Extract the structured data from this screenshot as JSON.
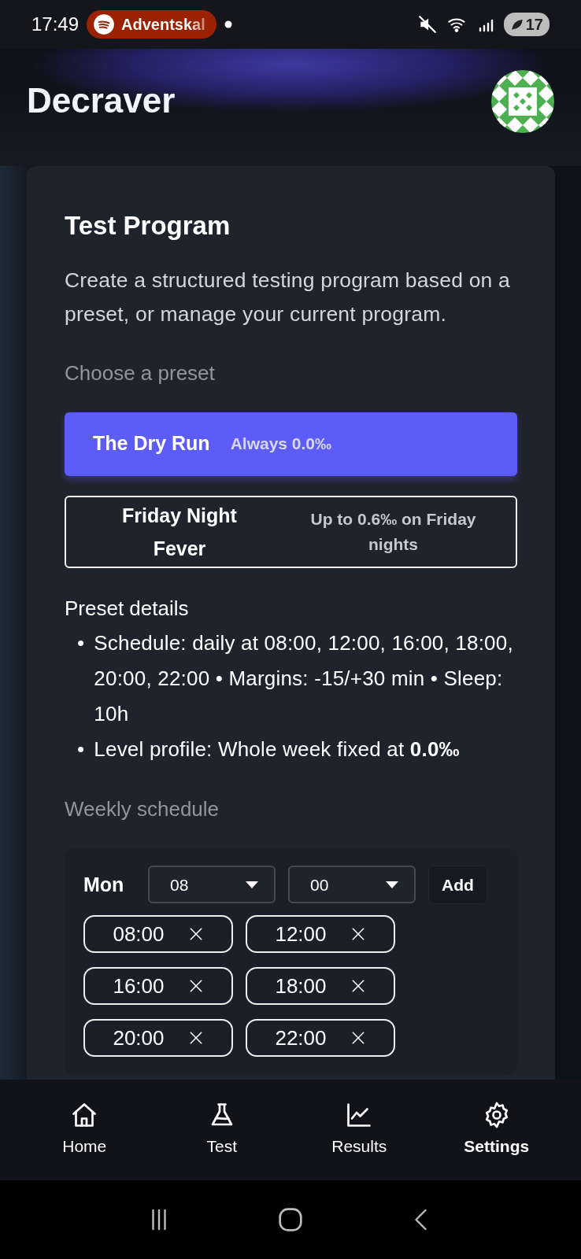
{
  "status_bar": {
    "time": "17:49",
    "media": "Adventskal",
    "battery": "17"
  },
  "app": {
    "title": "Decraver"
  },
  "card": {
    "title": "Test Program",
    "description": "Create a structured testing program based on a preset, or manage your current program.",
    "preset_label": "Choose a preset",
    "presets": [
      {
        "name": "The Dry Run",
        "summary": "Always 0.0‰",
        "selected": true
      },
      {
        "name": "Friday Night Fever",
        "summary": "Up to 0.6‰ on Friday nights",
        "selected": false
      }
    ],
    "details_heading": "Preset details",
    "details": [
      {
        "bullet": "•",
        "text": "Schedule: daily at 08:00, 12:00, 16:00, 18:00, 20:00, 22:00 • Margins: -15/+30 min • Sleep: 10h"
      },
      {
        "bullet": "•",
        "text": "Level profile: Whole week fixed at **0.0‰**"
      }
    ],
    "schedule_heading": "Weekly schedule",
    "schedule": {
      "day": "Mon",
      "hour": "08",
      "minute": "00",
      "add": "Add",
      "times": [
        "08:00",
        "12:00",
        "16:00",
        "18:00",
        "20:00",
        "22:00"
      ]
    }
  },
  "nav": [
    {
      "kind": "home",
      "label": "Home",
      "selected": false
    },
    {
      "kind": "test",
      "label": "Test",
      "selected": false
    },
    {
      "kind": "results",
      "label": "Results",
      "selected": false
    },
    {
      "kind": "settings",
      "label": "Settings",
      "selected": true
    }
  ]
}
